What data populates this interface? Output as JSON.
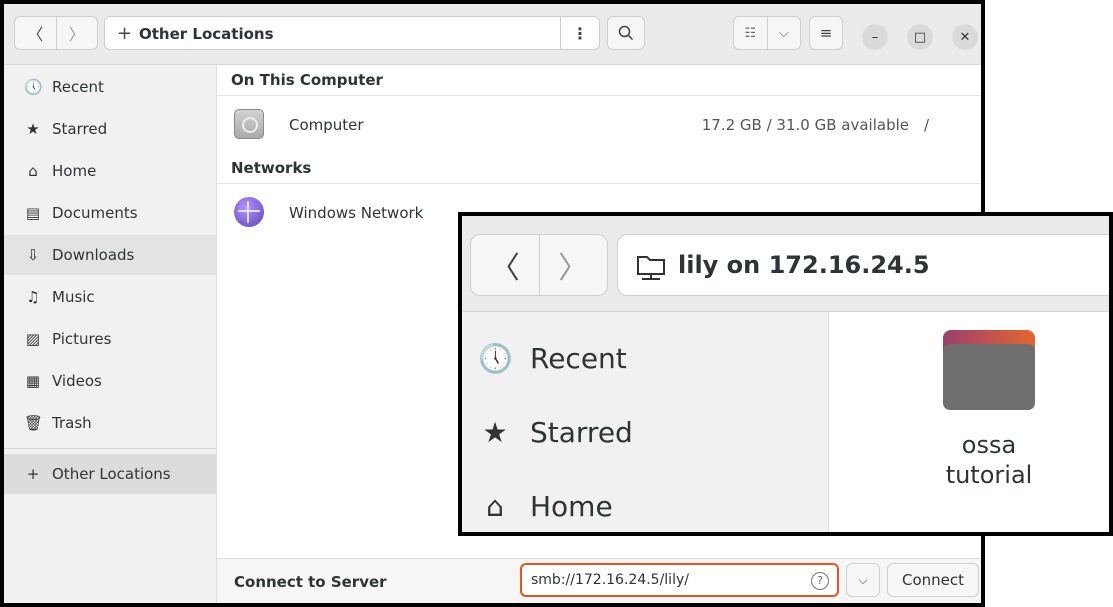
{
  "header": {
    "back_glyph": "〈",
    "forward_glyph": "〉",
    "location_plus": "+",
    "location": "Other Locations",
    "location_menu": "⋮",
    "search_glyph": "🔍",
    "view_glyph": "☷",
    "view_dropdown_glyph": "⌵",
    "main_menu_glyph": "≡",
    "minimize_glyph": "–",
    "maximize_glyph": "□",
    "close_glyph": "✕"
  },
  "sidebar": {
    "items": [
      {
        "label": "Recent",
        "icon": "🕔"
      },
      {
        "label": "Starred",
        "icon": "★"
      },
      {
        "label": "Home",
        "icon": "⌂"
      },
      {
        "label": "Documents",
        "icon": "▤"
      },
      {
        "label": "Downloads",
        "icon": "⇩"
      },
      {
        "label": "Music",
        "icon": "♫"
      },
      {
        "label": "Pictures",
        "icon": "▨"
      },
      {
        "label": "Videos",
        "icon": "▦"
      },
      {
        "label": "Trash",
        "icon": "🗑"
      }
    ],
    "other_locations": {
      "label": "Other Locations",
      "icon": "+"
    }
  },
  "content": {
    "section_computer": "On This Computer",
    "computer": {
      "name": "Computer",
      "space": "17.2 GB / 31.0 GB available",
      "mount": "/"
    },
    "section_networks": "Networks",
    "network": {
      "name": "Windows Network"
    }
  },
  "connect": {
    "label": "Connect to Server",
    "value": "smb://172.16.24.5/lily/",
    "help_glyph": "?",
    "dropdown_glyph": "⌵",
    "button": "Connect"
  },
  "zoom": {
    "back_glyph": "〈",
    "forward_glyph": "〉",
    "location": "lily on 172.16.24.5",
    "sidebar": [
      {
        "label": "Recent",
        "icon": "🕔"
      },
      {
        "label": "Starred",
        "icon": "★"
      },
      {
        "label": "Home",
        "icon": "⌂"
      }
    ],
    "folder_line1": "ossa",
    "folder_line2": "tutorial"
  }
}
